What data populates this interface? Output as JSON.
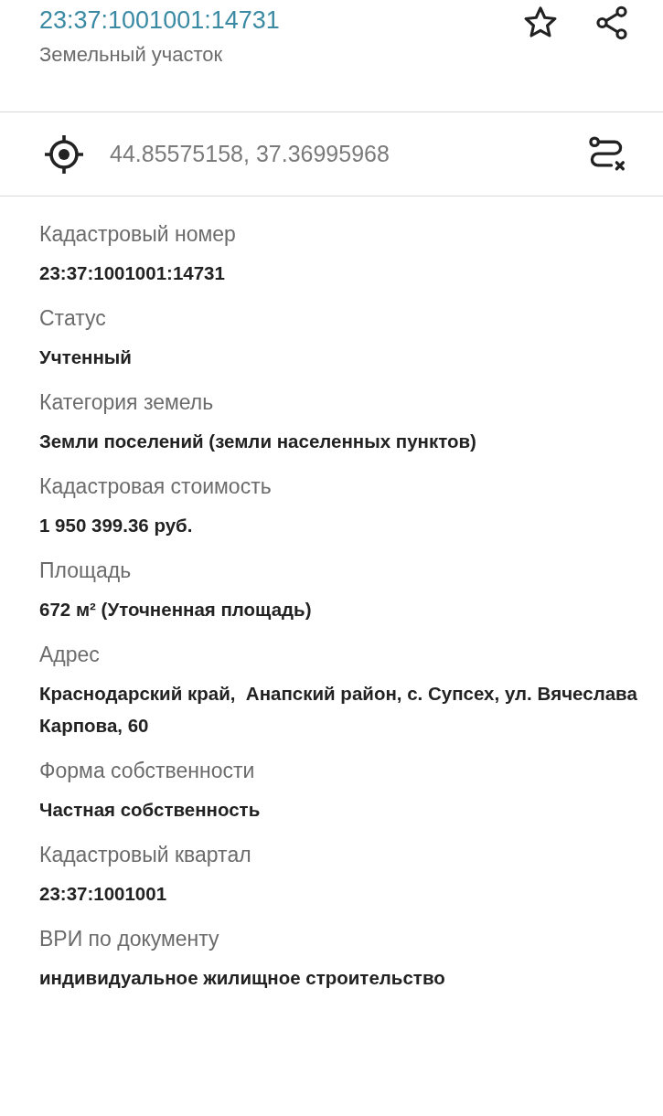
{
  "header": {
    "title": "23:37:1001001:14731",
    "subtitle": "Земельный участок",
    "favorite": false
  },
  "coordinates": {
    "text": "44.85575158, 37.36995968"
  },
  "fields": [
    {
      "label": "Кадастровый номер",
      "value": "23:37:1001001:14731"
    },
    {
      "label": "Статус",
      "value": "Учтенный"
    },
    {
      "label": "Категория земель",
      "value": "Земли поселений (земли населенных пунктов)"
    },
    {
      "label": "Кадастровая стоимость",
      "value": "1 950 399.36 руб."
    },
    {
      "label": "Площадь",
      "value": "672 м² (Уточненная площадь)"
    },
    {
      "label": "Адрес",
      "value": "Краснодарский край,  Анапский район, с. Супсех, ул. Вячеслава Карпова, 60"
    },
    {
      "label": "Форма собственности",
      "value": "Частная собственность"
    },
    {
      "label": "Кадастровый квартал",
      "value": "23:37:1001001"
    },
    {
      "label": "ВРИ по документу",
      "value": "индивидуальное жилищное строительство"
    }
  ]
}
